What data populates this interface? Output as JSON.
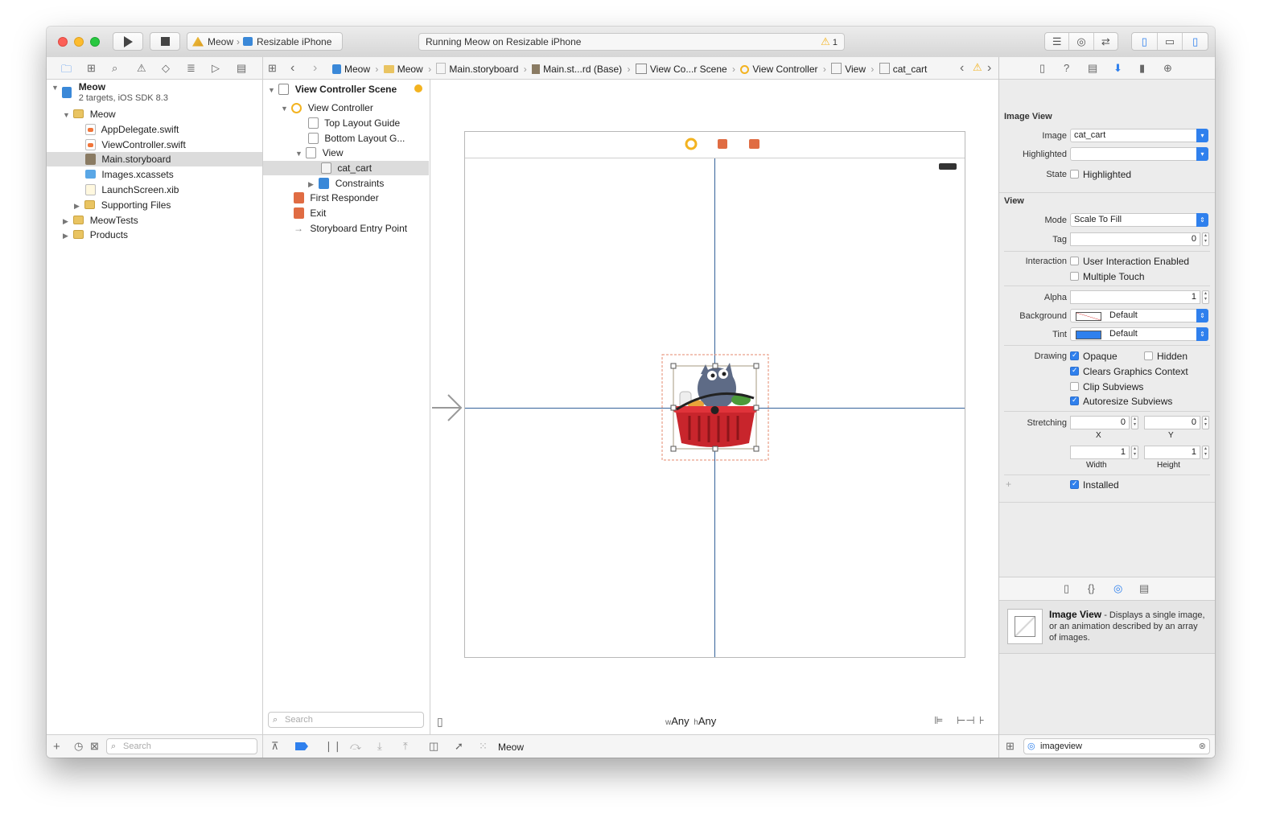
{
  "toolbar": {
    "scheme": "Meow",
    "destination": "Resizable iPhone",
    "activity_text": "Running Meow on Resizable iPhone",
    "warning_count": "1"
  },
  "jump_bar": {
    "items": [
      "Meow",
      "Meow",
      "Main.storyboard",
      "Main.st...rd (Base)",
      "View Co...r Scene",
      "View Controller",
      "View",
      "cat_cart"
    ]
  },
  "navigator": {
    "project_name": "Meow",
    "project_sub": "2 targets, iOS SDK 8.3",
    "group": "Meow",
    "files": [
      "AppDelegate.swift",
      "ViewController.swift",
      "Main.storyboard",
      "Images.xcassets",
      "LaunchScreen.xib"
    ],
    "supporting": "Supporting Files",
    "tests": "MeowTests",
    "products": "Products",
    "filter_placeholder": "Search"
  },
  "outline": {
    "scene": "View Controller Scene",
    "controller": "View Controller",
    "top_guide": "Top Layout Guide",
    "bottom_guide": "Bottom Layout G...",
    "view": "View",
    "image": "cat_cart",
    "constraints": "Constraints",
    "first_responder": "First Responder",
    "exit": "Exit",
    "entry_point": "Storyboard Entry Point",
    "filter_placeholder": "Search"
  },
  "canvas": {
    "size_w_prefix": "w",
    "size_w": "Any",
    "size_h_prefix": "h",
    "size_h": "Any"
  },
  "debug_bar": {
    "target": "Meow"
  },
  "inspector": {
    "image_view_title": "Image View",
    "image_label": "Image",
    "image_value": "cat_cart",
    "highlighted_label": "Highlighted",
    "highlighted_value": "",
    "state_label": "State",
    "state_option": "Highlighted",
    "view_title": "View",
    "mode_label": "Mode",
    "mode_value": "Scale To Fill",
    "tag_label": "Tag",
    "tag_value": "0",
    "interaction_label": "Interaction",
    "user_interaction": "User Interaction Enabled",
    "multiple_touch": "Multiple Touch",
    "alpha_label": "Alpha",
    "alpha_value": "1",
    "background_label": "Background",
    "background_value": "Default",
    "tint_label": "Tint",
    "tint_value": "Default",
    "drawing_label": "Drawing",
    "opaque": "Opaque",
    "hidden": "Hidden",
    "clears": "Clears Graphics Context",
    "clip": "Clip Subviews",
    "autoresize": "Autoresize Subviews",
    "stretching_label": "Stretching",
    "stretch_x": "0",
    "stretch_y": "0",
    "x_label": "X",
    "y_label": "Y",
    "stretch_w": "1",
    "stretch_h": "1",
    "width_label": "Width",
    "height_label": "Height",
    "installed": "Installed",
    "library_title": "Image View",
    "library_desc": " - Displays a single image, or an animation described by an array of images.",
    "library_filter": "imageview"
  },
  "colors": {
    "accent": "#2f80ed",
    "guide_line": "#35629a",
    "warning": "#f3b320"
  }
}
